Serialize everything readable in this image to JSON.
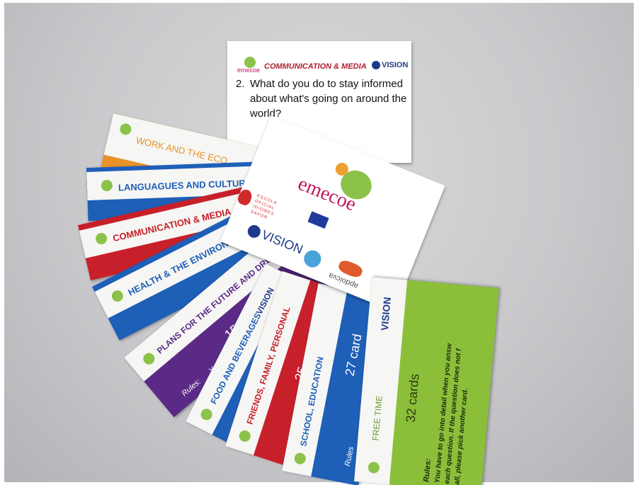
{
  "colors": {
    "orange": "#e8922a",
    "blue": "#1e5fb8",
    "red": "#c8202a",
    "purple": "#5b2a86",
    "green": "#8bbf3a",
    "brand_pink": "#c2185b",
    "brand_green": "#8bc34a"
  },
  "question_card": {
    "brand": "emecoe",
    "category": "COMMUNICATION & MEDIA",
    "partner": "VISION",
    "number": "2.",
    "question_line1": "What do you do to stay informed",
    "question_line2": "about what's going on around the",
    "question_line3": "world?"
  },
  "cover_card": {
    "brand": "emecoe",
    "partner": "VISION",
    "school_line1": "ESCOLA",
    "school_line2": "OFICIAL",
    "school_line3": "IDIOMES",
    "school_line4": "SAFOR",
    "sponsor": "apdoicva"
  },
  "category_cards": [
    {
      "label": "WORK AND THE ECO",
      "color": "orange"
    },
    {
      "label": "LANGUAGUES AND CULTURES",
      "color": "blue"
    },
    {
      "label": "COMMUNICATION & MEDIA",
      "color": "red"
    },
    {
      "label": "HEALTH & THE ENVIRONMENT",
      "color": "blue"
    },
    {
      "label": "PLANS FOR THE FUTURE AND DREAM",
      "color": "purple"
    },
    {
      "label": "FOOD AND BEVERAGES",
      "color": "blue"
    },
    {
      "label": "FRIENDS, FAMILY, PERSONAL",
      "color": "red"
    },
    {
      "label": "SCHOOL, EDUCATION",
      "color": "blue"
    }
  ],
  "card_fragments": {
    "count_15": "15 card",
    "count_25": "25",
    "count_27": "27 card",
    "you_have": "You ha",
    "rules": "Rules:",
    "rules_short": "Rules",
    "you_short": "You"
  },
  "free_time_card": {
    "label": "FREE TIME",
    "partner": "VISION",
    "count": "32 cards",
    "rules_label": "Rules:",
    "rules_line1": "You have to go into detail when you answ",
    "rules_line2": "each question. If the question does not f",
    "rules_line3": "all, please pick another card."
  }
}
